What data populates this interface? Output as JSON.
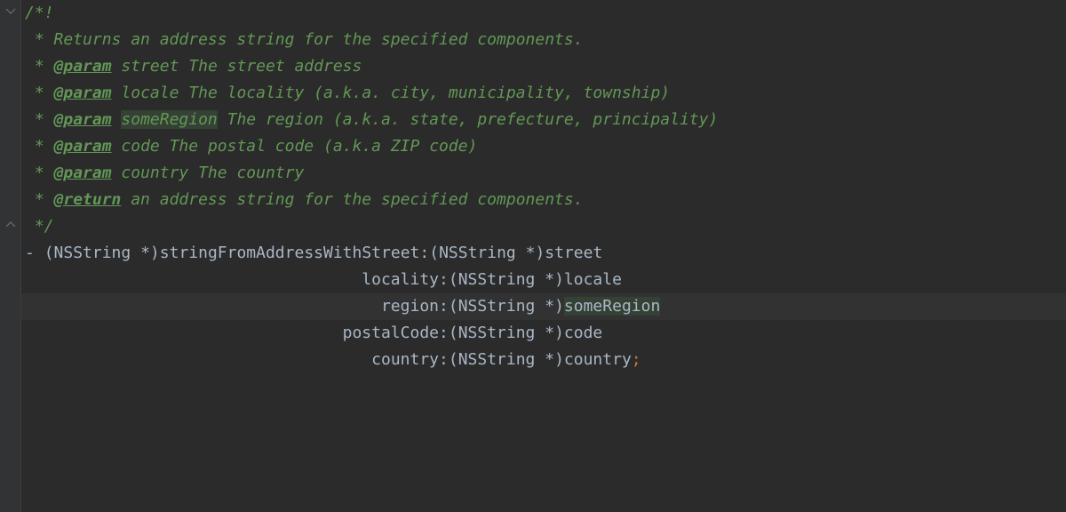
{
  "doc": {
    "open": "/*!",
    "l1_text": "Returns an address string for the specified components.",
    "l2_tag": "@param",
    "l2_name": "street",
    "l2_desc": "The street address",
    "l3_tag": "@param",
    "l3_name": "locale",
    "l3_desc": "The locality (a.k.a. city, municipality, township)",
    "l4_tag": "@param",
    "l4_name": "someRegion",
    "l4_desc": "The region (a.k.a. state, prefecture, principality)",
    "l5_tag": "@param",
    "l5_name": "code",
    "l5_desc": "The postal code (a.k.a ZIP code)",
    "l6_tag": "@param",
    "l6_name": "country",
    "l6_desc": "The country",
    "l7_tag": "@return",
    "l7_desc": "an address string for the specified components.",
    "close": " */",
    "star": " * "
  },
  "sig": {
    "dash": "- ",
    "lparen": "(",
    "rparen": ")",
    "star": " *",
    "ret_type": "NSString",
    "m0_name": "stringFromAddressWithStreet",
    "m0_indent": "",
    "m0_type": "NSString",
    "m0_param": "street",
    "m1_name": "locality",
    "m1_indent": "                                   ",
    "m1_type": "NSString",
    "m1_param": "locale",
    "m2_name": "region",
    "m2_indent": "                                     ",
    "m2_type": "NSString",
    "m2_param": "someRegion",
    "m3_name": "postalCode",
    "m3_indent": "                                 ",
    "m3_type": "NSString",
    "m3_param": "code",
    "m4_name": "country",
    "m4_indent": "                                    ",
    "m4_type": "NSString",
    "m4_param": "country",
    "colon": ":",
    "semi": ";"
  }
}
